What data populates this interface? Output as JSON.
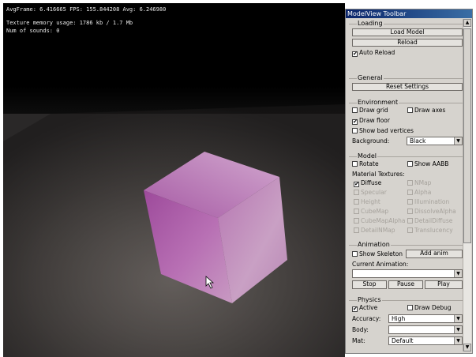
{
  "viewport": {
    "stats_line1": "AvgFrame: 6.416665  FPS: 155.844208 Avg: 6.246980",
    "stats_line2": "Texture memory usage: 1786 kb / 1.7 Mb",
    "stats_line3": "Num of sounds: 0"
  },
  "toolbar": {
    "title": "ModelView Toolbar",
    "loading": {
      "title": "Loading",
      "load_model": "Load Model",
      "reload": "Reload",
      "auto_reload": "Auto Reload",
      "auto_reload_checked": true
    },
    "general": {
      "title": "General",
      "reset_settings": "Reset Settings"
    },
    "environment": {
      "title": "Environment",
      "draw_grid": "Draw grid",
      "draw_axes": "Draw axes",
      "draw_floor": "Draw floor",
      "show_bad_vertices": "Show bad vertices",
      "background_label": "Background:",
      "background_value": "Black"
    },
    "model": {
      "title": "Model",
      "rotate": "Rotate",
      "show_aabb": "Show AABB",
      "material_textures_label": "Material Textures:",
      "textures": [
        {
          "label": "Diffuse",
          "checked": true,
          "enabled": true
        },
        {
          "label": "NMap",
          "checked": false,
          "enabled": false
        },
        {
          "label": "Specular",
          "checked": false,
          "enabled": false
        },
        {
          "label": "Alpha",
          "checked": false,
          "enabled": false
        },
        {
          "label": "Height",
          "checked": false,
          "enabled": false
        },
        {
          "label": "Illumination",
          "checked": false,
          "enabled": false
        },
        {
          "label": "CubeMap",
          "checked": false,
          "enabled": false
        },
        {
          "label": "DissolveAlpha",
          "checked": false,
          "enabled": false
        },
        {
          "label": "CubeMapAlpha",
          "checked": false,
          "enabled": false
        },
        {
          "label": "DetailDiffuse",
          "checked": false,
          "enabled": false
        },
        {
          "label": "DetailNMap",
          "checked": false,
          "enabled": false
        },
        {
          "label": "Translucency",
          "checked": false,
          "enabled": false
        }
      ]
    },
    "animation": {
      "title": "Animation",
      "show_skeleton": "Show Skeleton",
      "add_anim": "Add anim",
      "current_animation_label": "Current Animation:",
      "current_animation_value": "",
      "stop": "Stop",
      "pause": "Pause",
      "play": "Play"
    },
    "physics": {
      "title": "Physics",
      "active": "Active",
      "active_checked": true,
      "draw_debug": "Draw Debug",
      "accuracy_label": "Accuracy:",
      "accuracy_value": "High",
      "body_label": "Body:",
      "body_value": "",
      "mat_label": "Mat:",
      "mat_value": "Default"
    }
  },
  "colors": {
    "cube_front": "#b25fb0",
    "cube_side": "#8e3f8e",
    "cube_top": "#c98ac8",
    "titlebar": "#0a246a",
    "panel_bg": "#d6d3ce"
  }
}
